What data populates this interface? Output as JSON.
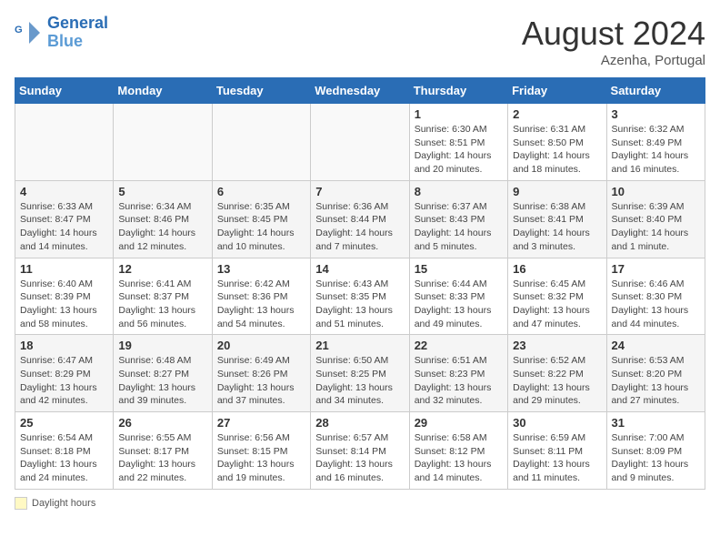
{
  "header": {
    "logo_line1": "General",
    "logo_line2": "Blue",
    "month_year": "August 2024",
    "location": "Azenha, Portugal"
  },
  "weekdays": [
    "Sunday",
    "Monday",
    "Tuesday",
    "Wednesday",
    "Thursday",
    "Friday",
    "Saturday"
  ],
  "weeks": [
    [
      {
        "day": "",
        "detail": ""
      },
      {
        "day": "",
        "detail": ""
      },
      {
        "day": "",
        "detail": ""
      },
      {
        "day": "",
        "detail": ""
      },
      {
        "day": "1",
        "detail": "Sunrise: 6:30 AM\nSunset: 8:51 PM\nDaylight: 14 hours and 20 minutes."
      },
      {
        "day": "2",
        "detail": "Sunrise: 6:31 AM\nSunset: 8:50 PM\nDaylight: 14 hours and 18 minutes."
      },
      {
        "day": "3",
        "detail": "Sunrise: 6:32 AM\nSunset: 8:49 PM\nDaylight: 14 hours and 16 minutes."
      }
    ],
    [
      {
        "day": "4",
        "detail": "Sunrise: 6:33 AM\nSunset: 8:47 PM\nDaylight: 14 hours and 14 minutes."
      },
      {
        "day": "5",
        "detail": "Sunrise: 6:34 AM\nSunset: 8:46 PM\nDaylight: 14 hours and 12 minutes."
      },
      {
        "day": "6",
        "detail": "Sunrise: 6:35 AM\nSunset: 8:45 PM\nDaylight: 14 hours and 10 minutes."
      },
      {
        "day": "7",
        "detail": "Sunrise: 6:36 AM\nSunset: 8:44 PM\nDaylight: 14 hours and 7 minutes."
      },
      {
        "day": "8",
        "detail": "Sunrise: 6:37 AM\nSunset: 8:43 PM\nDaylight: 14 hours and 5 minutes."
      },
      {
        "day": "9",
        "detail": "Sunrise: 6:38 AM\nSunset: 8:41 PM\nDaylight: 14 hours and 3 minutes."
      },
      {
        "day": "10",
        "detail": "Sunrise: 6:39 AM\nSunset: 8:40 PM\nDaylight: 14 hours and 1 minute."
      }
    ],
    [
      {
        "day": "11",
        "detail": "Sunrise: 6:40 AM\nSunset: 8:39 PM\nDaylight: 13 hours and 58 minutes."
      },
      {
        "day": "12",
        "detail": "Sunrise: 6:41 AM\nSunset: 8:37 PM\nDaylight: 13 hours and 56 minutes."
      },
      {
        "day": "13",
        "detail": "Sunrise: 6:42 AM\nSunset: 8:36 PM\nDaylight: 13 hours and 54 minutes."
      },
      {
        "day": "14",
        "detail": "Sunrise: 6:43 AM\nSunset: 8:35 PM\nDaylight: 13 hours and 51 minutes."
      },
      {
        "day": "15",
        "detail": "Sunrise: 6:44 AM\nSunset: 8:33 PM\nDaylight: 13 hours and 49 minutes."
      },
      {
        "day": "16",
        "detail": "Sunrise: 6:45 AM\nSunset: 8:32 PM\nDaylight: 13 hours and 47 minutes."
      },
      {
        "day": "17",
        "detail": "Sunrise: 6:46 AM\nSunset: 8:30 PM\nDaylight: 13 hours and 44 minutes."
      }
    ],
    [
      {
        "day": "18",
        "detail": "Sunrise: 6:47 AM\nSunset: 8:29 PM\nDaylight: 13 hours and 42 minutes."
      },
      {
        "day": "19",
        "detail": "Sunrise: 6:48 AM\nSunset: 8:27 PM\nDaylight: 13 hours and 39 minutes."
      },
      {
        "day": "20",
        "detail": "Sunrise: 6:49 AM\nSunset: 8:26 PM\nDaylight: 13 hours and 37 minutes."
      },
      {
        "day": "21",
        "detail": "Sunrise: 6:50 AM\nSunset: 8:25 PM\nDaylight: 13 hours and 34 minutes."
      },
      {
        "day": "22",
        "detail": "Sunrise: 6:51 AM\nSunset: 8:23 PM\nDaylight: 13 hours and 32 minutes."
      },
      {
        "day": "23",
        "detail": "Sunrise: 6:52 AM\nSunset: 8:22 PM\nDaylight: 13 hours and 29 minutes."
      },
      {
        "day": "24",
        "detail": "Sunrise: 6:53 AM\nSunset: 8:20 PM\nDaylight: 13 hours and 27 minutes."
      }
    ],
    [
      {
        "day": "25",
        "detail": "Sunrise: 6:54 AM\nSunset: 8:18 PM\nDaylight: 13 hours and 24 minutes."
      },
      {
        "day": "26",
        "detail": "Sunrise: 6:55 AM\nSunset: 8:17 PM\nDaylight: 13 hours and 22 minutes."
      },
      {
        "day": "27",
        "detail": "Sunrise: 6:56 AM\nSunset: 8:15 PM\nDaylight: 13 hours and 19 minutes."
      },
      {
        "day": "28",
        "detail": "Sunrise: 6:57 AM\nSunset: 8:14 PM\nDaylight: 13 hours and 16 minutes."
      },
      {
        "day": "29",
        "detail": "Sunrise: 6:58 AM\nSunset: 8:12 PM\nDaylight: 13 hours and 14 minutes."
      },
      {
        "day": "30",
        "detail": "Sunrise: 6:59 AM\nSunset: 8:11 PM\nDaylight: 13 hours and 11 minutes."
      },
      {
        "day": "31",
        "detail": "Sunrise: 7:00 AM\nSunset: 8:09 PM\nDaylight: 13 hours and 9 minutes."
      }
    ]
  ],
  "legend": {
    "daylight_label": "Daylight hours"
  }
}
